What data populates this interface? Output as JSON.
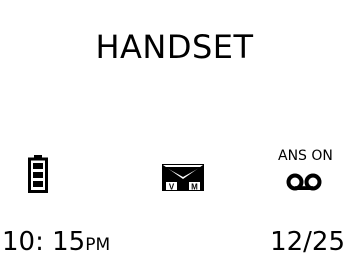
{
  "screen": {
    "title": "HANDSET",
    "status": {
      "battery_icon": "battery-full-icon",
      "voicemail_icon": "voicemail-envelope-icon",
      "voicemail_letters": [
        "V",
        "M"
      ],
      "answering_machine_label": "ANS ON",
      "answering_machine_icon": "cassette-tape-icon"
    },
    "clock": {
      "time": "10: 15",
      "ampm": "PM"
    },
    "date": "12/25"
  }
}
